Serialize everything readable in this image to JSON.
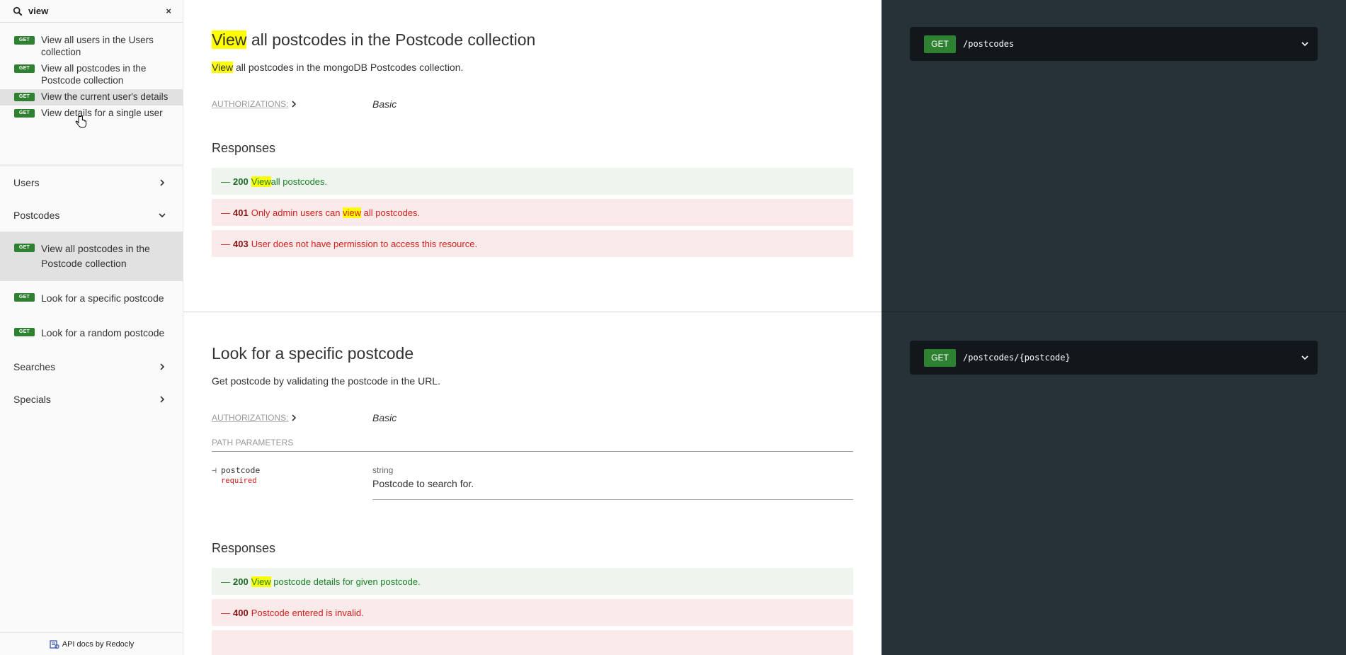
{
  "sidebar": {
    "search": {
      "query": "view",
      "clear": "×"
    },
    "results": [
      {
        "badge": "GET",
        "label": "View all users in the Users collection"
      },
      {
        "badge": "GET",
        "label": "View all postcodes in the Postcode collection"
      },
      {
        "badge": "GET",
        "label": "View the current user's details"
      },
      {
        "badge": "GET",
        "label": "View details for a single user"
      }
    ],
    "groups": [
      {
        "label": "Users"
      },
      {
        "label": "Postcodes"
      },
      {
        "label": "Searches"
      },
      {
        "label": "Specials"
      }
    ],
    "postcode_ops": [
      {
        "badge": "GET",
        "label": "View all postcodes in the Postcode collection"
      },
      {
        "badge": "GET",
        "label": "Look for a specific postcode"
      },
      {
        "badge": "GET",
        "label": "Look for a random postcode"
      }
    ],
    "footer": "API docs by Redocly"
  },
  "op1": {
    "title_hl": "View",
    "title_rest": " all postcodes in the Postcode collection",
    "desc_hl": "View",
    "desc_rest": " all postcodes in the mongoDB Postcodes collection.",
    "auth_label": "AUTHORIZATIONS:",
    "auth_value": "Basic",
    "responses_title": "Responses",
    "responses": [
      {
        "dash": "—",
        "code": "200",
        "pre": "",
        "hl": "View",
        "post": " all postcodes."
      },
      {
        "dash": "—",
        "code": "401",
        "pre": "Only admin users can ",
        "hl": "view",
        "post": " all postcodes."
      },
      {
        "dash": "—",
        "code": "403",
        "text": "User does not have permission to access this resource."
      }
    ],
    "endpoint": {
      "method": "GET",
      "path": "/postcodes"
    }
  },
  "op2": {
    "title": "Look for a specific postcode",
    "desc": "Get postcode by validating the postcode in the URL.",
    "auth_label": "AUTHORIZATIONS:",
    "auth_value": "Basic",
    "params_label": "PATH PARAMETERS",
    "param": {
      "name": "postcode",
      "required": "required",
      "type": "string",
      "desc": "Postcode to search for."
    },
    "responses_title": "Responses",
    "responses": [
      {
        "dash": "—",
        "code": "200",
        "hl": "View",
        "post": " postcode details for given postcode."
      },
      {
        "dash": "—",
        "code": "400",
        "text": "Postcode entered is invalid."
      }
    ],
    "endpoint": {
      "method": "GET",
      "path": "/postcodes/{postcode}"
    }
  },
  "colors": {
    "get_badge": "#2f8132",
    "highlight": "#ffff00",
    "right_panel": "#263238",
    "success": "#1d8127",
    "error": "#d41f1c"
  }
}
